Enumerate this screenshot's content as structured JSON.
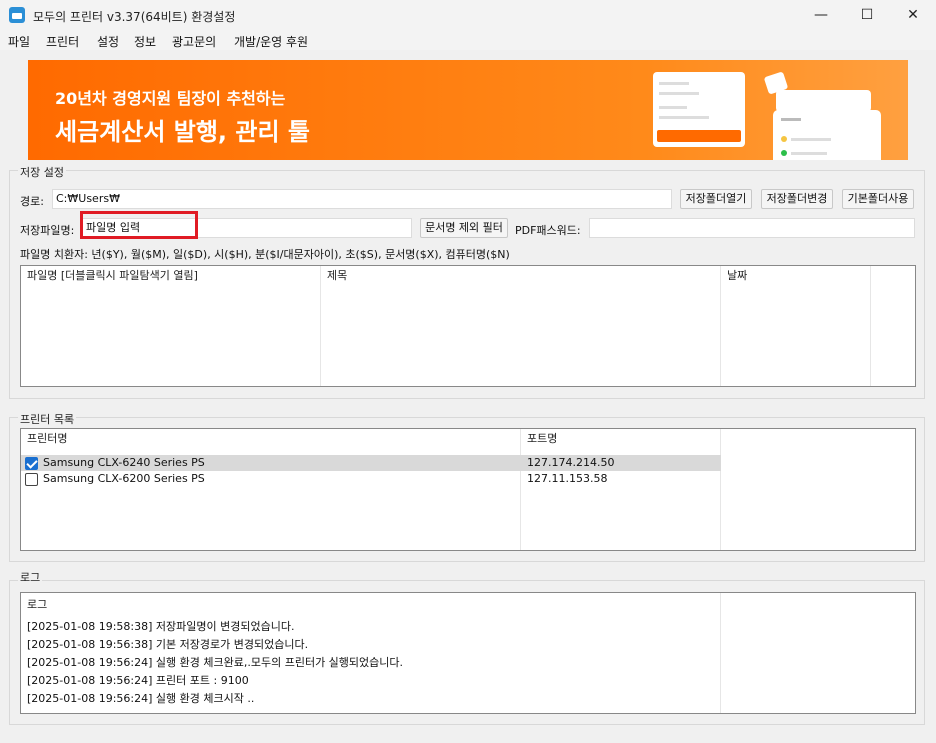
{
  "window": {
    "title": "모두의 프린터 v3.37(64비트) 환경설정",
    "minimize": "—",
    "maximize": "☐",
    "close": "✕"
  },
  "menu": [
    "파일",
    "프린터",
    "설정",
    "정보",
    "광고문의",
    "개발/운영 후원"
  ],
  "banner": {
    "subtitle": "20년차 경영지원 팀장이 추천하는",
    "headline": "세금계산서 발행, 관리 툴"
  },
  "save_settings": {
    "group_title": "저장 설정",
    "path_label": "경로:",
    "path_value": "C:₩Users₩",
    "open_folder": "저장폴더열기",
    "change_folder": "저장폴더변경",
    "use_default_folder": "기본폴더사용",
    "filename_label": "저장파일명:",
    "filename_value": "파일명 입력",
    "filter_button": "문서명 제외 필터",
    "pdf_password_label": "PDF패스워드:",
    "pdf_password_value": "",
    "substitutions": "파일명 치환자: 년($Y), 월($M), 일($D), 시($H), 분($I/대문자아이), 초($S), 문서명($X), 컴퓨터명($N)",
    "columns": [
      "파일명 [더블클릭시 파일탐색기 열림]",
      "제목",
      "날짜"
    ]
  },
  "printers": {
    "group_title": "프린터 목록",
    "columns": [
      "프린터명",
      "포트명"
    ],
    "rows": [
      {
        "name": "Samsung CLX-6240 Series PS",
        "port": "127.174.214.50",
        "checked": true
      },
      {
        "name": "Samsung CLX-6200 Series PS",
        "port": "127.11.153.58",
        "checked": false
      }
    ]
  },
  "log": {
    "group_title": "로그",
    "header": "로그",
    "lines": [
      "[2025-01-08 19:58:38] 저장파일명이 변경되었습니다.",
      "[2025-01-08 19:56:38] 기본 저장경로가 변경되었습니다.",
      "[2025-01-08 19:56:24] 실행 환경 체크완료,.모두의 프린터가 실행되었습니다.",
      "[2025-01-08 19:56:24] 프린터 포트 : 9100",
      "[2025-01-08 19:56:24] 실행 환경 체크시작 .."
    ]
  },
  "colors": {
    "banner": "#ff6a00",
    "highlight": "#e01b24",
    "checkbox": "#1a6fd0"
  }
}
